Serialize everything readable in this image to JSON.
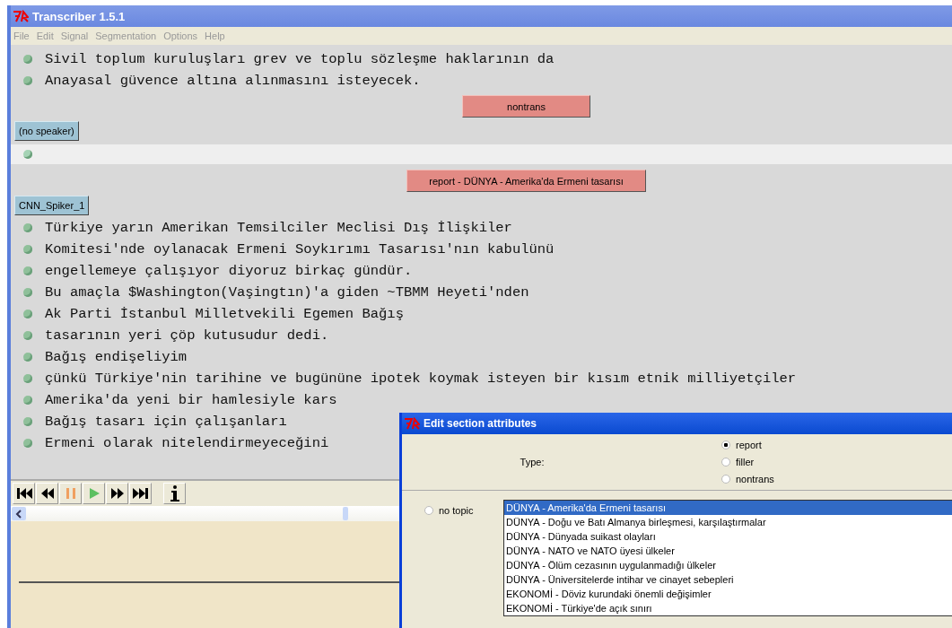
{
  "window": {
    "title": "Transcriber 1.5.1"
  },
  "menu": [
    "File",
    "Edit",
    "Signal",
    "Segmentation",
    "Options",
    "Help"
  ],
  "transcript": [
    {
      "kind": "text",
      "text": "Sivil toplum kuruluşları grev ve toplu sözleşme haklarının da"
    },
    {
      "kind": "text",
      "text": "Anayasal güvence altına alınmasını isteyecek."
    },
    {
      "kind": "section",
      "text": "nontrans"
    },
    {
      "kind": "speaker",
      "text": "(no speaker)"
    },
    {
      "kind": "empty",
      "selected": true
    },
    {
      "kind": "section",
      "text": "report - DÜNYA - Amerika'da Ermeni tasarısı"
    },
    {
      "kind": "speaker",
      "text": "CNN_Spiker_1"
    },
    {
      "kind": "text",
      "text": "Türkiye yarın Amerikan Temsilciler Meclisi Dış İlişkiler"
    },
    {
      "kind": "text",
      "text": "Komitesi'nde oylanacak Ermeni Soykırımı Tasarısı'nın kabulünü"
    },
    {
      "kind": "text",
      "text": "engellemeye çalışıyor diyoruz birkaç gündür."
    },
    {
      "kind": "text",
      "text": "Bu amaçla $Washington(Vaşingtın)'a giden ~TBMM Heyeti'nden"
    },
    {
      "kind": "text",
      "text": "Ak Parti İstanbul Milletvekili Egemen Bağış"
    },
    {
      "kind": "text",
      "text": "tasarının yeri çöp kutusudur dedi."
    },
    {
      "kind": "text",
      "text": "Bağış endişeliyim"
    },
    {
      "kind": "text",
      "text": "çünkü Türkiye'nin tarihine ve bugününe ipotek koymak isteyen bir kısım etnik milliyetçiler"
    },
    {
      "kind": "text",
      "text": "Amerika'da yeni bir hamlesiyle kars"
    },
    {
      "kind": "text",
      "text": "Bağış tasarı için çalışanları"
    },
    {
      "kind": "text",
      "text": "Ermeni olarak nitelendirmeyeceğini"
    }
  ],
  "dialog": {
    "title": "Edit section attributes",
    "type_label": "Type:",
    "types": [
      {
        "label": "report",
        "selected": true
      },
      {
        "label": "filler",
        "selected": false
      },
      {
        "label": "nontrans",
        "selected": false
      }
    ],
    "no_topic": {
      "label": "no topic",
      "selected": false
    },
    "topics": [
      {
        "label": "DÜNYA - Amerika'da Ermeni tasarısı",
        "selected": true
      },
      {
        "label": "DÜNYA - Doğu ve Batı Almanya birleşmesi, karşılaştırmalar",
        "selected": false
      },
      {
        "label": "DÜNYA - Dünyada suikast olayları",
        "selected": false
      },
      {
        "label": "DÜNYA - NATO ve NATO üyesi ülkeler",
        "selected": false
      },
      {
        "label": "DÜNYA - Ölüm cezasının uygulanmadığı ülkeler",
        "selected": false
      },
      {
        "label": "DÜNYA - Üniversitelerde intihar ve cinayet sebepleri",
        "selected": false
      },
      {
        "label": "EKONOMİ - Döviz kurundaki önemli değişimler",
        "selected": false
      },
      {
        "label": "EKONOMİ - Türkiye'de açık sınırı",
        "selected": false
      }
    ]
  }
}
